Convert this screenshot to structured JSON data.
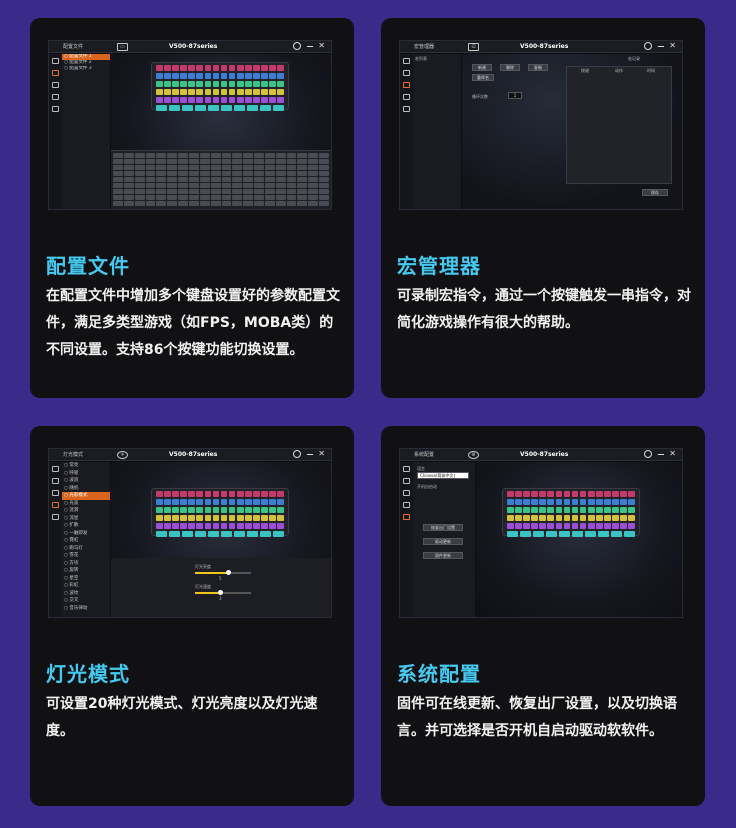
{
  "colors": {
    "page_bg": "#3a2a8a",
    "card_bg": "#111114",
    "title": "#46c9f0",
    "accent_orange": "#d9651d",
    "slider_yellow": "#f0c419"
  },
  "cards": [
    {
      "title": "配置文件",
      "desc": "在配置文件中增加多个键盘设置好的参数配置文件，满足多类型游戏（如FPS，MOBA类）的不同设置。支持86个按键功能切换设置。",
      "shot": {
        "window_label": "配置文件",
        "app_title": "V500-87series",
        "list_items": [
          "配置文件 1",
          "配置文件 2",
          "配置文件 3"
        ],
        "active_index": 0
      }
    },
    {
      "title": "宏管理器",
      "desc": "可录制宏指令，通过一个按键触发一串指令，对简化游戏操作有很大的帮助。",
      "shot": {
        "window_label": "宏管理器",
        "app_title": "V500-87series",
        "list_header": "宏列表",
        "buttons": [
          "新建",
          "删除",
          "复制",
          "重命名"
        ],
        "right_header": "宏记录",
        "cols": [
          "按键",
          "动作",
          "时间"
        ],
        "save_label": "保存",
        "loop_label": "循环次数",
        "loop_value": "1"
      }
    },
    {
      "title": "灯光模式",
      "desc": "可设置20种灯光模式、灯光亮度以及灯光速度。",
      "shot": {
        "window_label": "灯光模式",
        "app_title": "V500-87series",
        "list_items": [
          "常亮",
          "呼吸",
          "波浪",
          "随机",
          "光影模式",
          "光波",
          "涟漪",
          "流星",
          "扩散",
          "一触即发",
          "霓虹",
          "跑马灯",
          "雪花",
          "方块",
          "旋转",
          "星空",
          "彩虹",
          "波纹",
          "交叉",
          "音乐律动"
        ],
        "active_index": 4,
        "brightness_label": "灯光亮度",
        "brightness_value": 0.6,
        "brightness_num": "5",
        "speed_label": "灯光速度",
        "speed_value": 0.45,
        "speed_num": "3"
      }
    },
    {
      "title": "系统配置",
      "desc": "固件可在线更新、恢复出厂设置，以及切换语言。并可选择是否开机自启动驱动软软件。",
      "shot": {
        "window_label": "系统配置",
        "app_title": "V500-87series",
        "lang_label": "语言",
        "lang_value": "Chinese(简体中文)",
        "autostart_label": "开机自启动",
        "buttons": [
          "恢复出厂设置",
          "驱动更新",
          "固件更新"
        ]
      }
    }
  ]
}
